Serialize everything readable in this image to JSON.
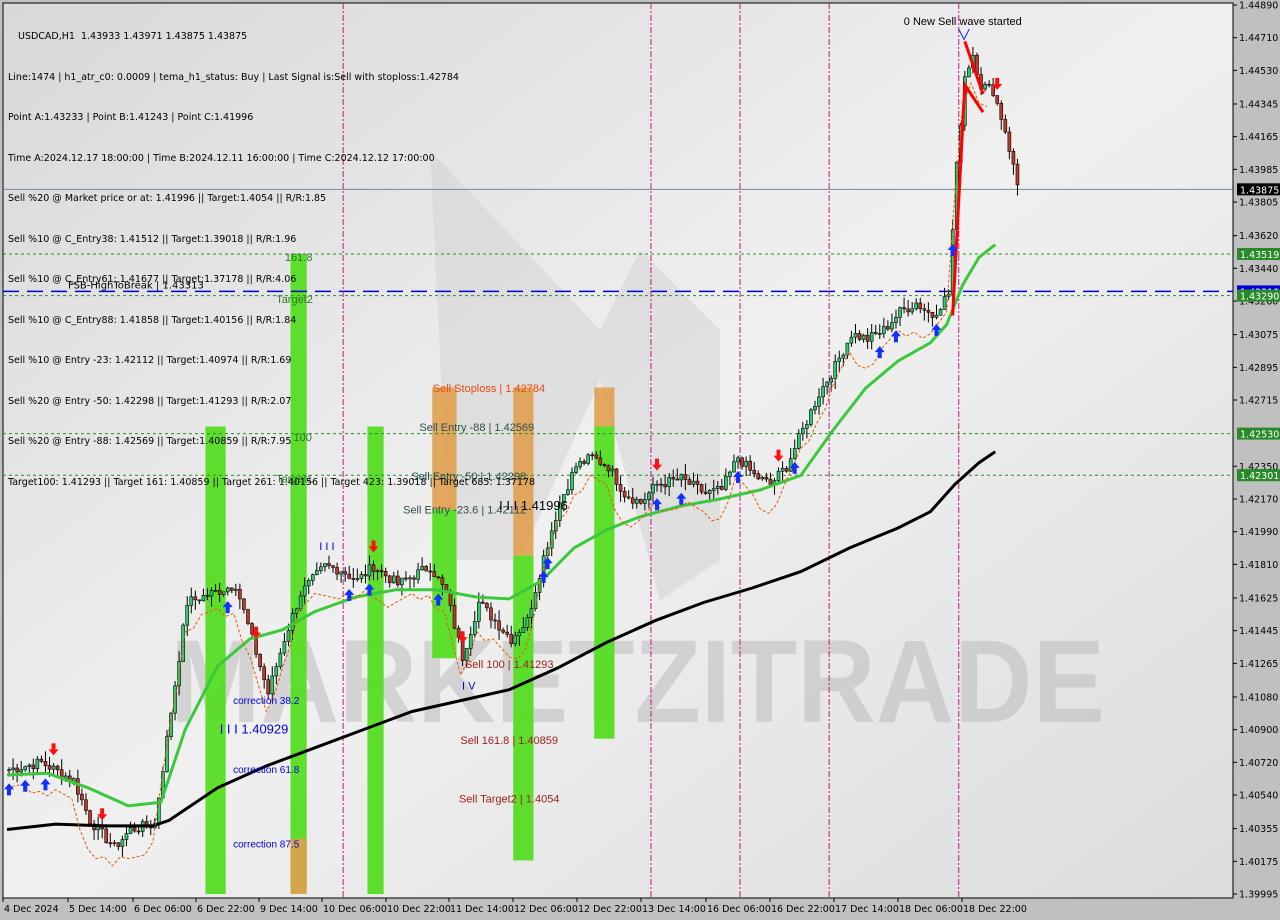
{
  "window": {
    "symbol_line": "USDCAD,H1  1.43933 1.43971 1.43875 1.43875"
  },
  "info_lines": [
    "Line:1474 | h1_atr_c0: 0.0009 | tema_h1_status: Buy | Last Signal is:Sell with stoploss:1.42784",
    "Point A:1.43233 | Point B:1.41243 | Point C:1.41996",
    "Time A:2024.12.17 18:00:00 | Time B:2024.12.11 16:00:00 | Time C:2024.12.12 17:00:00",
    "Sell %20 @ Market price or at: 1.41996 || Target:1.4054 || R/R:1.85",
    "Sell %10 @ C_Entry38: 1.41512 || Target:1.39018 || R/R:1.96",
    "Sell %10 @ C_Entry61: 1.41677 || Target:1.37178 || R/R:4.06",
    "Sell %10 @ C_Entry88: 1.41858 || Target:1.40156 || R/R:1.84",
    "Sell %10 @ Entry -23: 1.42112 || Target:1.40974 || R/R:1.69",
    "Sell %20 @ Entry -50: 1.42298 || Target:1.41293 || R/R:2.07",
    "Sell %20 @ Entry -88: 1.42569 || Target:1.40859 || R/R:7.95",
    "Target100: 1.41293 || Target 161: 1.40859 || Target 261: 1.40156 || Target 423: 1.39018 || Target 685: 1.37178"
  ],
  "colors": {
    "background": "#e4e4e4",
    "axis_bg": "#c0c0c0",
    "bull_candle": "#2ecc71",
    "bear_candle": "#c0392b",
    "ema_green": "#3cc83c",
    "ma_black": "#000000",
    "green_zone": "#55dd22",
    "orange_zone": "#e0a050",
    "stop_orange": "#e85a00",
    "price_tag": "#000000",
    "level_tag": "#2a8a2a",
    "fsb_blue": "#0000dd",
    "vline_magenta": "#cc1188"
  },
  "chart_data": {
    "type": "candlestick",
    "title": "USDCAD,H1",
    "ohlc_last": {
      "open": 1.43933,
      "high": 1.43971,
      "low": 1.43875,
      "close": 1.43875
    },
    "ylim": [
      1.39995,
      1.4489
    ],
    "y_ticks": [
      "1.44890",
      "1.44710",
      "1.44530",
      "1.44345",
      "1.44165",
      "1.43985",
      "1.43805",
      "1.43620",
      "1.43440",
      "1.43260",
      "1.43075",
      "1.42895",
      "1.42715",
      "1.42350",
      "1.42170",
      "1.41990",
      "1.41810",
      "1.41625",
      "1.41445",
      "1.41265",
      "1.41080",
      "1.40900",
      "1.40720",
      "1.40540",
      "1.40355",
      "1.40175",
      "1.39995"
    ],
    "y_tick_values": [
      1.4489,
      1.4471,
      1.4453,
      1.44345,
      1.44165,
      1.43985,
      1.43805,
      1.4362,
      1.4344,
      1.4326,
      1.43075,
      1.42895,
      1.42715,
      1.4235,
      1.4217,
      1.4199,
      1.4181,
      1.41625,
      1.41445,
      1.41265,
      1.4108,
      1.409,
      1.4072,
      1.4054,
      1.40355,
      1.40175,
      1.39995
    ],
    "x_ticks": [
      "4 Dec 2024",
      "5 Dec 14:00",
      "6 Dec 06:00",
      "6 Dec 22:00",
      "9 Dec 14:00",
      "10 Dec 06:00",
      "10 Dec 22:00",
      "11 Dec 14:00",
      "12 Dec 06:00",
      "12 Dec 22:00",
      "13 Dec 14:00",
      "16 Dec 06:00",
      "16 Dec 22:00",
      "17 Dec 14:00",
      "18 Dec 06:00",
      "18 Dec 22:00"
    ],
    "x_tick_bar_index": [
      0,
      16,
      32,
      48,
      64,
      80,
      96,
      112,
      128,
      144,
      160,
      176,
      192,
      208,
      224,
      240
    ],
    "price_tags": [
      {
        "label": "1.43875",
        "value": 1.43875,
        "kind": "current"
      },
      {
        "label": "1.43519",
        "value": 1.43519,
        "kind": "level"
      },
      {
        "label": "1.43313",
        "value": 1.43313,
        "kind": "fsb"
      },
      {
        "label": "1.43290",
        "value": 1.4329,
        "kind": "level"
      },
      {
        "label": "1.42530",
        "value": 1.4253,
        "kind": "level"
      },
      {
        "label": "1.42301",
        "value": 1.42301,
        "kind": "level"
      }
    ],
    "horizontal_levels": [
      {
        "value": 1.43519,
        "style": "green-dotted"
      },
      {
        "value": 1.4329,
        "style": "green-dotted"
      },
      {
        "value": 1.4253,
        "style": "green-dotted"
      },
      {
        "value": 1.42301,
        "style": "green-dotted"
      },
      {
        "value": 1.43313,
        "style": "blue-dashed",
        "label": "FSB-HighToBreak | 1.43313"
      },
      {
        "value": 1.43875,
        "style": "grey-solid"
      }
    ],
    "vertical_markers_bar_index": [
      83,
      159,
      181,
      203,
      235
    ],
    "zones": [
      {
        "from_bar": 49,
        "to_bar": 54,
        "top": 1.42569,
        "bottom": 1.39995,
        "color": "green"
      },
      {
        "from_bar": 70,
        "to_bar": 74,
        "top": 1.43519,
        "bottom": 1.39995,
        "color": "green"
      },
      {
        "from_bar": 70,
        "to_bar": 74,
        "top": 1.403,
        "bottom": 1.39995,
        "color": "orange"
      },
      {
        "from_bar": 89,
        "to_bar": 93,
        "top": 1.42569,
        "bottom": 1.39995,
        "color": "green"
      },
      {
        "from_bar": 105,
        "to_bar": 111,
        "top": 1.42784,
        "bottom": 1.42112,
        "color": "orange"
      },
      {
        "from_bar": 105,
        "to_bar": 111,
        "top": 1.42112,
        "bottom": 1.41293,
        "color": "green"
      },
      {
        "from_bar": 125,
        "to_bar": 130,
        "top": 1.42784,
        "bottom": 1.41858,
        "color": "orange"
      },
      {
        "from_bar": 125,
        "to_bar": 130,
        "top": 1.41858,
        "bottom": 1.4018,
        "color": "green"
      },
      {
        "from_bar": 145,
        "to_bar": 150,
        "top": 1.42784,
        "bottom": 1.42569,
        "color": "orange"
      },
      {
        "from_bar": 145,
        "to_bar": 150,
        "top": 1.42569,
        "bottom": 1.4085,
        "color": "green"
      }
    ],
    "annotations": [
      {
        "text": "0 New Sell wave started",
        "bar": 236,
        "value": 1.4478,
        "color": "#000000",
        "size": 11
      },
      {
        "text": "161.8",
        "bar": 72,
        "value": 1.4348,
        "color": "#2a7a2a",
        "size": 11
      },
      {
        "text": "Target2",
        "bar": 71,
        "value": 1.4325,
        "color": "#2a7a2a",
        "size": 11
      },
      {
        "text": "100",
        "bar": 73,
        "value": 1.4249,
        "color": "#2a7a2a",
        "size": 11
      },
      {
        "text": "Target1",
        "bar": 71,
        "value": 1.4226,
        "color": "#2a7a2a",
        "size": 11
      },
      {
        "text": "Sell Stoploss | 1.42784",
        "bar": 119,
        "value": 1.4276,
        "color": "#e84a10",
        "size": 11
      },
      {
        "text": "Sell Entry -88 | 1.42569",
        "bar": 116,
        "value": 1.42545,
        "color": "#2f4f4f",
        "size": 11
      },
      {
        "text": "Sell Entry -50 | 1.42298",
        "bar": 114,
        "value": 1.42275,
        "color": "#2f4f4f",
        "size": 11
      },
      {
        "text": "Sell Entry -23.6 | 1.42112",
        "bar": 113,
        "value": 1.4209,
        "color": "#2f4f4f",
        "size": 11
      },
      {
        "text": "I I I 1.41996",
        "bar": 130,
        "value": 1.4211,
        "color": "#000000",
        "size": 13
      },
      {
        "text": "Sell 100 | 1.41293",
        "bar": 124,
        "value": 1.4124,
        "color": "#a02020",
        "size": 11
      },
      {
        "text": "Sell 161.8 | 1.40859",
        "bar": 124,
        "value": 1.4082,
        "color": "#a02020",
        "size": 11
      },
      {
        "text": "Sell Target2 | 1.4054",
        "bar": 124,
        "value": 1.405,
        "color": "#a02020",
        "size": 11
      },
      {
        "text": "correction 38.2",
        "bar": 64,
        "value": 1.4104,
        "color": "#0000dd",
        "size": 10
      },
      {
        "text": "I I I 1.40929",
        "bar": 61,
        "value": 1.4088,
        "color": "#0000dd",
        "size": 13
      },
      {
        "text": "correction 61.8",
        "bar": 64,
        "value": 1.4066,
        "color": "#0000dd",
        "size": 10
      },
      {
        "text": "correction 87.5",
        "bar": 64,
        "value": 1.4025,
        "color": "#0000dd",
        "size": 10
      },
      {
        "text": "I V",
        "bar": 114,
        "value": 1.4112,
        "color": "#0000dd",
        "size": 11
      },
      {
        "text": "I I I",
        "bar": 79,
        "value": 1.4189,
        "color": "#0000dd",
        "size": 11
      }
    ],
    "watermark": "MARKETZITRADE"
  }
}
